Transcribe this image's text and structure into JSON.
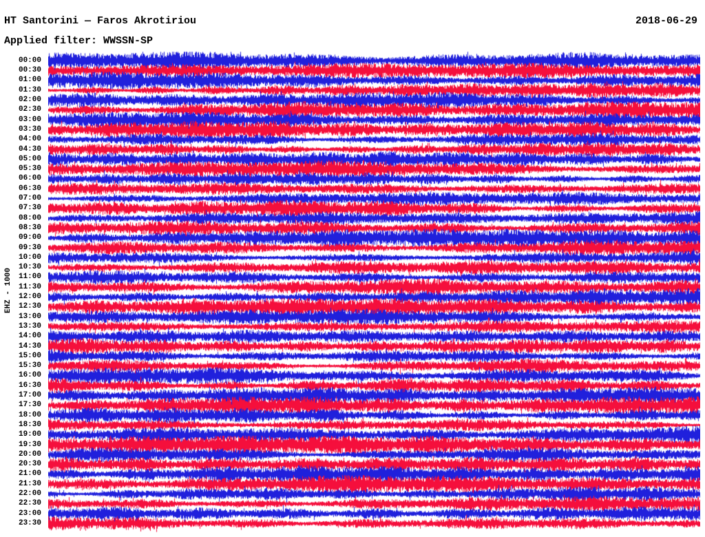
{
  "header": {
    "title": "HT Santorini — Faros Akrotiriou",
    "date": "2018-06-29",
    "filter_line": "Applied filter: WWSSN-SP"
  },
  "y_axis": {
    "label": "EHZ - 1000"
  },
  "colors": {
    "background": "#FFFFFF",
    "text": "#000000",
    "trace_blue": "#2020DC",
    "trace_red": "#F50F3C"
  },
  "chart_data": {
    "type": "line",
    "subtype": "helicorder-drum-plot",
    "title": "HT Santorini — Faros Akrotiriou",
    "date": "2018-06-29",
    "applied_filter": "WWSSN-SP",
    "channel_scale_label": "EHZ - 1000",
    "station_channel": "EHZ",
    "scale_factor": 1000,
    "row_interval_minutes": 30,
    "rows_per_day": 48,
    "row_color_alternation": [
      "#2020DC",
      "#F50F3C"
    ],
    "first_row_color": "#2020DC",
    "rows": [
      "00:00",
      "00:30",
      "01:00",
      "01:30",
      "02:00",
      "02:30",
      "03:00",
      "03:30",
      "04:00",
      "04:30",
      "05:00",
      "05:30",
      "06:00",
      "06:30",
      "07:00",
      "07:30",
      "08:00",
      "08:30",
      "09:00",
      "09:30",
      "10:00",
      "10:30",
      "11:00",
      "11:30",
      "12:00",
      "12:30",
      "13:00",
      "13:30",
      "14:00",
      "14:30",
      "15:00",
      "15:30",
      "16:00",
      "16:30",
      "17:00",
      "17:30",
      "18:00",
      "18:30",
      "19:00",
      "19:30",
      "20:00",
      "20:30",
      "21:00",
      "21:30",
      "22:00",
      "22:30",
      "23:00",
      "23:30"
    ],
    "legend_position": "none",
    "grid": false,
    "description": "Continuous 24-hour single-channel seismogram; every 30-minute row is a dense high-amplitude noise trace whose peaks overlap the neighbouring rows, producing alternating blue/red saturated bands across the full plot width."
  }
}
